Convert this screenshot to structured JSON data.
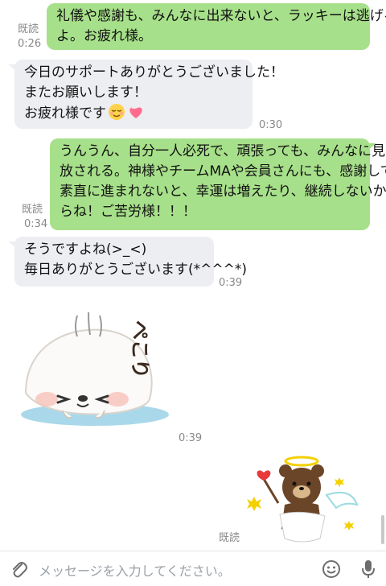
{
  "messages": [
    {
      "side": "out",
      "lines": [
        "礼儀や感謝も、みんなに出来ないと、ラッキーは逃げる",
        "よ。お疲れ様。"
      ],
      "read": "既読",
      "time": "0:26"
    },
    {
      "side": "in",
      "lines": [
        "今日のサポートありがとうございました！",
        "またお願いします！",
        "お疲れ様です"
      ],
      "time": "0:30"
    },
    {
      "side": "out",
      "lines": [
        "うんうん、自分一人必死で、頑張っても、みんなに見",
        "放される。神様やチームMAや会員さんにも、感謝して",
        "素直に進まれないと、幸運は増えたり、継続しないか",
        "らね！ご苦労様！！！"
      ],
      "read": "既読",
      "time": "0:34"
    },
    {
      "side": "in",
      "lines": [
        "そうですよね(>_<)",
        "毎日ありがとうございます(*^^^*)"
      ],
      "time": "0:39"
    },
    {
      "side": "in",
      "sticker": "seal-bowing-sticker",
      "sticker_text": "ぺこり",
      "time": "0:39"
    },
    {
      "side": "out",
      "sticker": "cupid-bear-sticker",
      "read": "既読"
    }
  ],
  "input": {
    "placeholder": "メッセージを入力してください。"
  },
  "icons": {
    "attach": "paperclip-icon",
    "emoji": "smiley-icon",
    "mic": "microphone-icon"
  },
  "colors": {
    "outgoing_bubble": "#a7e08a",
    "incoming_bubble": "#eceef2",
    "meta_text": "#888888"
  }
}
